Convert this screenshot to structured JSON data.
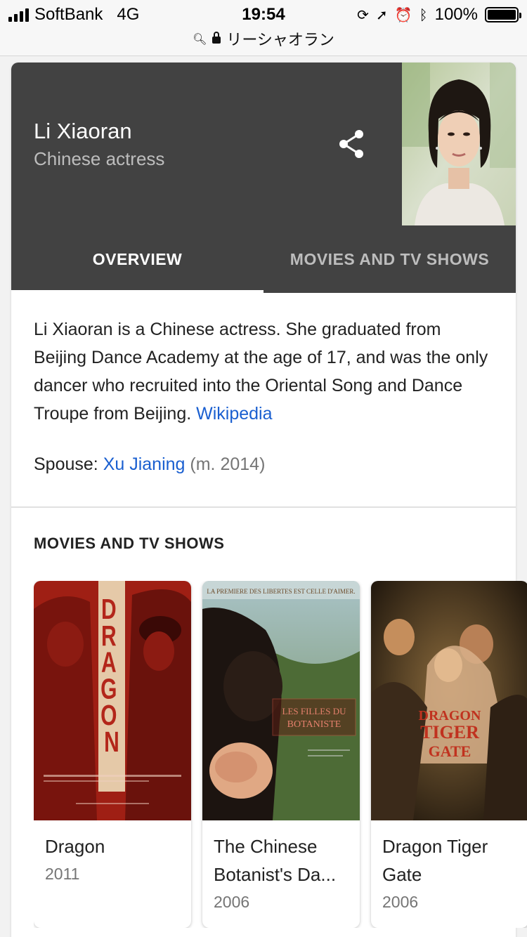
{
  "status_bar": {
    "carrier": "SoftBank",
    "network": "4G",
    "time": "19:54",
    "battery": "100%",
    "battery_level": 1.0,
    "icons": [
      "signal-icon",
      "orientation-lock-icon",
      "location-icon",
      "alarm-icon",
      "bluetooth-icon",
      "battery-icon"
    ]
  },
  "url_bar": {
    "text": "リーシャオラン",
    "icons": [
      "search-icon",
      "lock-icon"
    ]
  },
  "panel": {
    "title": "Li Xiaoran",
    "subtitle": "Chinese actress",
    "share_icon": "share-icon",
    "colors": {
      "header_bg": "#424242",
      "link": "#1a5fd0"
    }
  },
  "tabs": [
    {
      "label": "OVERVIEW",
      "active": true
    },
    {
      "label": "MOVIES AND TV SHOWS",
      "active": false
    }
  ],
  "overview": {
    "description": "Li Xiaoran is a Chinese actress. She graduated from Beijing Dance Academy at the age of 17, and was the only dancer who recruited into the Oriental Song and Dance Troupe from Beijing.",
    "source_link": "Wikipedia",
    "spouse_label": "Spouse:",
    "spouse_name": "Xu Jianing",
    "spouse_detail": "(m. 2014)"
  },
  "movies_section": {
    "heading": "MOVIES AND TV SHOWS",
    "items": [
      {
        "title": "Dragon",
        "year": "2011",
        "poster_text": "DRAGON"
      },
      {
        "title": "The Chinese Botanist's Da...",
        "year": "2006",
        "poster_text": "LES FILLES DU BOTANISTE",
        "poster_tagline": "LA PREMIERE DES LIBERTES EST CELLE D'AIMER."
      },
      {
        "title": "Dragon Tiger Gate",
        "year": "2006",
        "poster_text": "DRAGON TIGER GATE"
      }
    ]
  }
}
